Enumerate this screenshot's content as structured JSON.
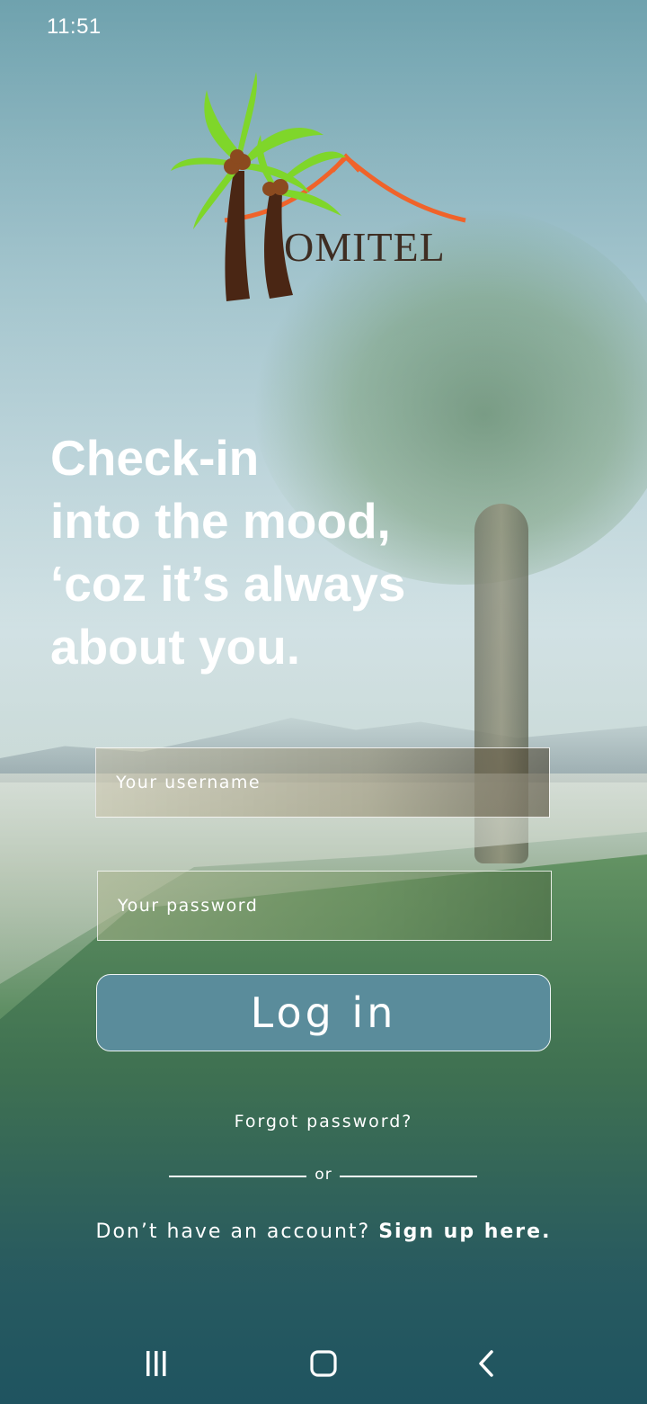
{
  "status_bar": {
    "time": "11:51"
  },
  "logo": {
    "wordmark": "OMITEL"
  },
  "tagline": {
    "lines": [
      "Check-in",
      "into the mood,",
      "‘coz it’s always",
      "about you."
    ]
  },
  "login_form": {
    "username_placeholder": "Your username",
    "password_placeholder": "Your password",
    "login_label": "Log in",
    "forgot_password": "Forgot password?",
    "divider_text": "or",
    "signup_prompt": "Don’t have an account?",
    "signup_link": "Sign up here."
  },
  "nav_bar": {
    "icons": [
      "recents-icon",
      "home-icon",
      "back-icon"
    ]
  },
  "colors": {
    "button_fill": "#5a8c9b",
    "logo_leaves": "#7fd62a",
    "logo_trunk": "#4a2614",
    "logo_roof": "#f0632a",
    "text": "#ffffff"
  }
}
